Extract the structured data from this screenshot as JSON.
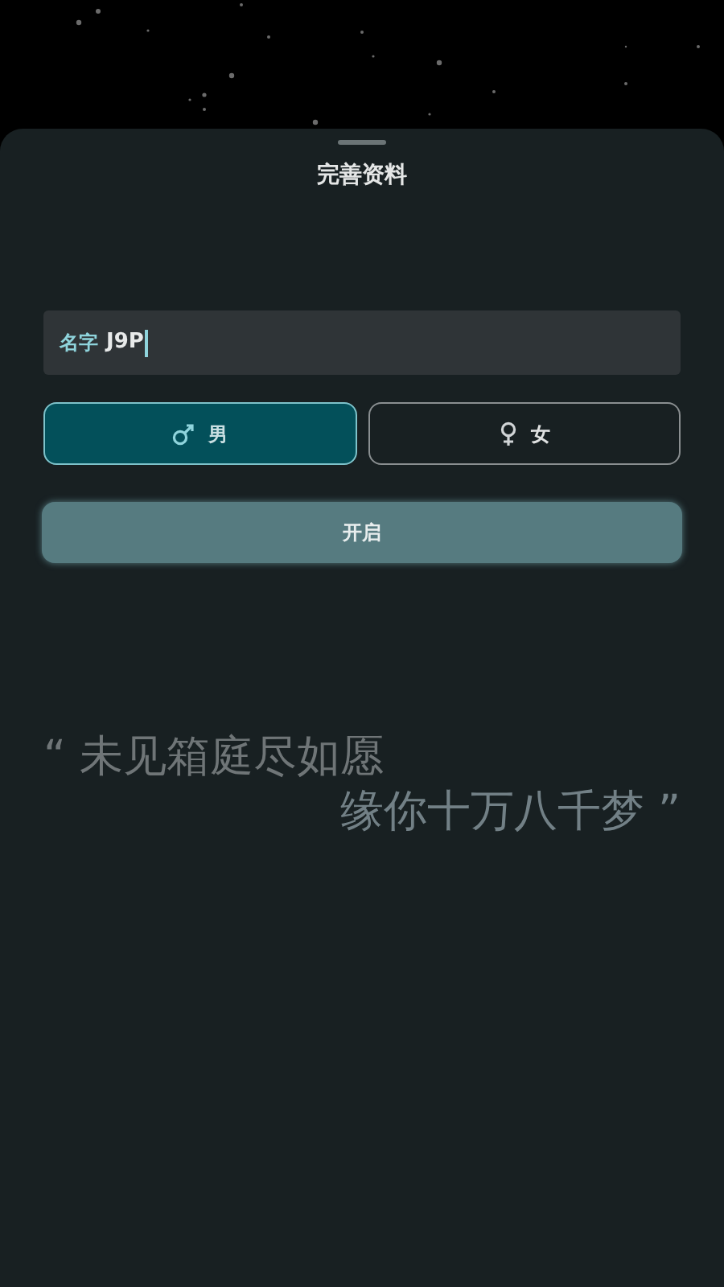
{
  "sheet": {
    "title": "完善资料"
  },
  "name_field": {
    "label": "名字",
    "value": "J9P"
  },
  "genders": [
    {
      "kind": "male",
      "label": "男",
      "selected": true
    },
    {
      "kind": "female",
      "label": "女",
      "selected": false
    }
  ],
  "submit": {
    "label": "开启"
  },
  "quote": {
    "open_mark": "“",
    "line_1": "未见箱庭尽如愿",
    "line_2": "缘你十万八千梦",
    "close_mark": "”"
  }
}
